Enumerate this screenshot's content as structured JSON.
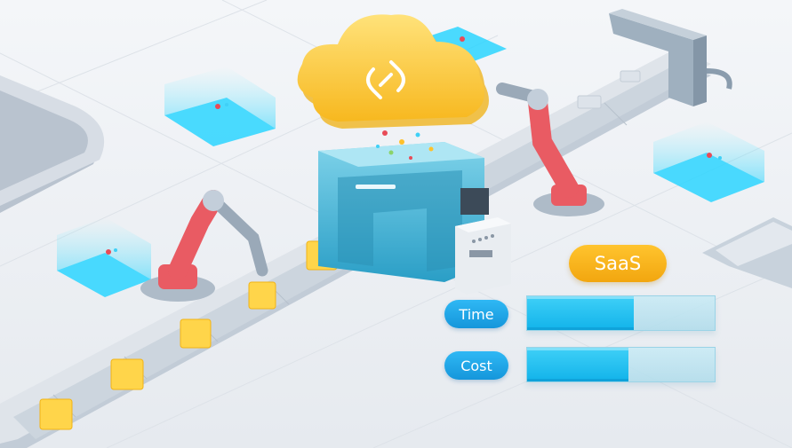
{
  "badge": {
    "label": "SaaS"
  },
  "metrics": [
    {
      "label": "Time",
      "fill_fraction": 0.57
    },
    {
      "label": "Cost",
      "fill_fraction": 0.54
    }
  ],
  "icons": [
    "cloud-icon",
    "saas-link-icon",
    "robot-arm-icon",
    "conveyor-belt-icon",
    "control-panel-icon"
  ],
  "colors": {
    "badge": "#f7b21c",
    "pill": "#1aa3e8",
    "bar_fill": "#1cc0f0",
    "bar_track": "#c4e6ef",
    "cloud": "#ffd24a",
    "robot": "#e95b63",
    "machine": "#3fb3d6"
  }
}
